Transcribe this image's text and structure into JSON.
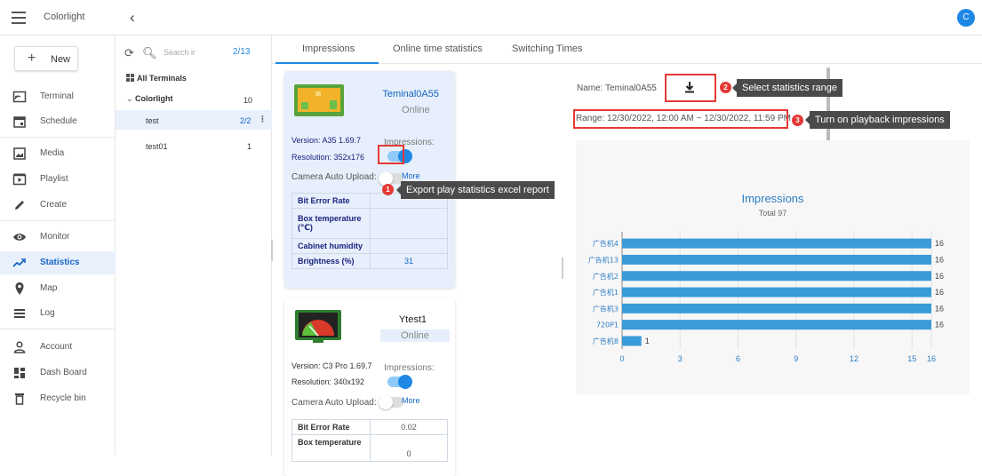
{
  "app": {
    "title": "Colorlight",
    "collapse_glyph": "‹",
    "avatar": "C"
  },
  "sidebar": {
    "new_label": "New",
    "items": [
      {
        "label": "Terminal",
        "icon": "terminal-icon"
      },
      {
        "label": "Schedule",
        "icon": "calendar-icon"
      },
      {
        "label": "Media",
        "icon": "media-icon"
      },
      {
        "label": "Playlist",
        "icon": "playlist-icon"
      },
      {
        "label": "Create",
        "icon": "pencil-icon"
      },
      {
        "label": "Monitor",
        "icon": "eye-icon"
      },
      {
        "label": "Statistics",
        "icon": "chart-line-icon",
        "active": true
      },
      {
        "label": "Map",
        "icon": "map-pin-icon"
      },
      {
        "label": "Log",
        "icon": "list-icon"
      },
      {
        "label": "Account",
        "icon": "person-icon"
      },
      {
        "label": "Dash Board",
        "icon": "dashboard-icon"
      },
      {
        "label": "Recycle bin",
        "icon": "trash-icon"
      }
    ]
  },
  "tree": {
    "search_placeholder": "Search ir",
    "page_count": "2/13",
    "all_terminals": "All Terminals",
    "group": {
      "label": "Colorlight",
      "count": "10"
    },
    "children": [
      {
        "label": "test",
        "count": "2/2",
        "selected": true
      },
      {
        "label": "test01",
        "count": "1"
      }
    ]
  },
  "tabs": [
    "Impressions",
    "Online time statistics",
    "Switching Times"
  ],
  "terminals": [
    {
      "name": "Teminal0A55",
      "status": "Online",
      "version": "Version: A35 1.69.7",
      "resolution": "Resolution: 352x176",
      "impressions_label": "Impressions:",
      "camera_label": "Camera Auto Upload:",
      "more": "More",
      "metrics": [
        {
          "key": "Bit Error Rate",
          "value": ""
        },
        {
          "key": "Box temperature (℃)",
          "value": ""
        },
        {
          "key": "Cabinet humidity",
          "value": ""
        },
        {
          "key": "Brightness (%)",
          "value": "31"
        }
      ]
    },
    {
      "name": "Ytest1",
      "status": "Online",
      "version": "Version: C3 Pro 1.69.7",
      "resolution": "Resolution: 340x192",
      "impressions_label": "Impressions:",
      "camera_label": "Camera Auto Upload:",
      "more": "More",
      "metrics": [
        {
          "key": "Bit Error Rate",
          "value": "0.02"
        },
        {
          "key": "Box temperature",
          "value": "0"
        }
      ]
    }
  ],
  "annotations": [
    {
      "num": "1",
      "text": "Export play statistics excel report"
    },
    {
      "num": "2",
      "text": "Select statistics range"
    },
    {
      "num": "3",
      "text": "Turn on playback impressions"
    }
  ],
  "stats": {
    "name_label": "Name:  Teminal0A55",
    "range_label": "Range:  12/30/2022, 12:00 AM ~ 12/30/2022, 11:59 PM"
  },
  "chart_data": {
    "type": "bar",
    "orientation": "horizontal",
    "title": "Impressions",
    "subtitle": "Total 97",
    "categories": [
      "广告机4",
      "广告机13",
      "广告机2",
      "广告机1",
      "广告机3",
      "720P1",
      "广告机8"
    ],
    "values": [
      16,
      16,
      16,
      16,
      16,
      16,
      1
    ],
    "xlim": [
      0,
      16
    ],
    "xticks": [
      0,
      3,
      6,
      9,
      12,
      15,
      16
    ],
    "bar_color": "#3a9bd9",
    "grid": true
  },
  "colors": {
    "accent": "#1e88e5",
    "annotation_red": "#e53935",
    "tooltip_bg": "#4a4a4a"
  }
}
